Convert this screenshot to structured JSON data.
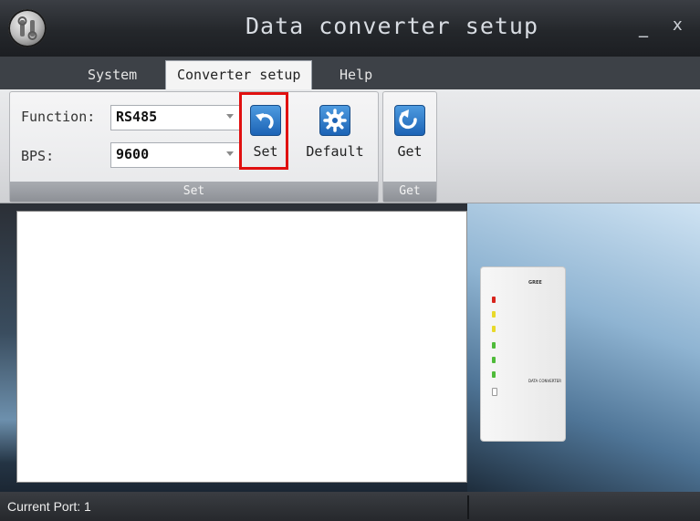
{
  "window": {
    "title": "Data converter setup",
    "minimize": "_",
    "close": "x"
  },
  "tabs": [
    "System",
    "Converter setup",
    "Help"
  ],
  "ribbon": {
    "set_group": {
      "function_label": "Function:",
      "function_value": "RS485",
      "bps_label": "BPS:",
      "bps_value": "9600",
      "set_button": "Set",
      "default_button": "Default",
      "footer": "Set"
    },
    "get_group": {
      "get_button": "Get",
      "footer": "Get"
    }
  },
  "status": {
    "current_port": "Current Port: 1"
  },
  "colors": {
    "highlight": "#e01010",
    "icon_blue": "#1c63b5"
  }
}
